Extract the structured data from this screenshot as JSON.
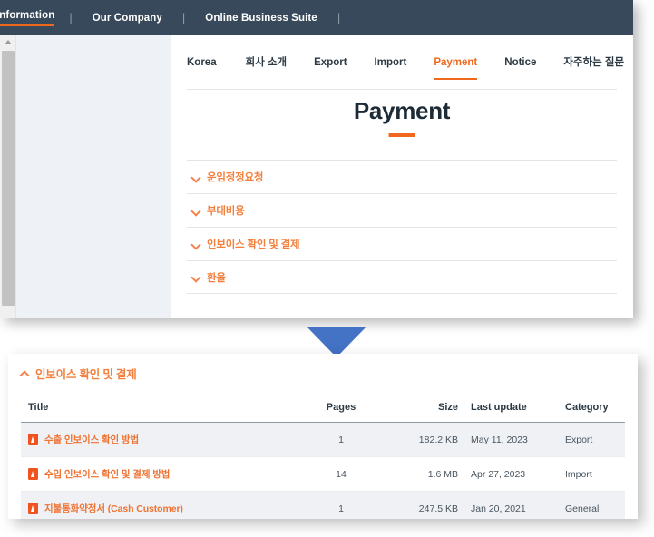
{
  "topnav": {
    "items": [
      {
        "label": "Information",
        "active": true
      },
      {
        "label": "Our Company",
        "active": false
      },
      {
        "label": "Online Business Suite",
        "active": false
      }
    ],
    "separator": "|"
  },
  "subtabs": [
    {
      "label": "Korea",
      "active": false
    },
    {
      "label": "회사 소개",
      "active": false
    },
    {
      "label": "Export",
      "active": false
    },
    {
      "label": "Import",
      "active": false
    },
    {
      "label": "Payment",
      "active": true
    },
    {
      "label": "Notice",
      "active": false
    },
    {
      "label": "자주하는 질문",
      "active": false
    }
  ],
  "page": {
    "title": "Payment"
  },
  "accordion": [
    {
      "label": "운임정정요청",
      "expanded": false
    },
    {
      "label": "부대비용",
      "expanded": false
    },
    {
      "label": "인보이스 확인 및 결제",
      "expanded": false
    },
    {
      "label": "환율",
      "expanded": false
    }
  ],
  "detail": {
    "header": "인보이스 확인 및 결제",
    "columns": [
      "Title",
      "Pages",
      "Size",
      "Last update",
      "Category"
    ],
    "rows": [
      {
        "title": "수출 인보이스 확인 방법",
        "pages": "1",
        "size": "182.2 KB",
        "last_update": "May 11, 2023",
        "category": "Export"
      },
      {
        "title": "수입 인보이스 확인 및 결제 방법",
        "pages": "14",
        "size": "1.6 MB",
        "last_update": "Apr 27, 2023",
        "category": "Import"
      },
      {
        "title": "지불통화약정서 (Cash Customer)",
        "pages": "1",
        "size": "247.5 KB",
        "last_update": "Jan 20, 2021",
        "category": "General"
      }
    ]
  },
  "icons": {
    "scroll_up": "triangle-up-icon",
    "chevron_down": "chevron-down-icon",
    "chevron_up": "chevron-up-icon",
    "pdf": "pdf-file-icon",
    "callout_arrow": "triangle-down-icon"
  },
  "colors": {
    "navy": "#37495a",
    "orange": "#f0681e",
    "orange_light": "#f4803e",
    "blue_arrow": "#4472c4",
    "row_stripe": "#eff1f5"
  }
}
